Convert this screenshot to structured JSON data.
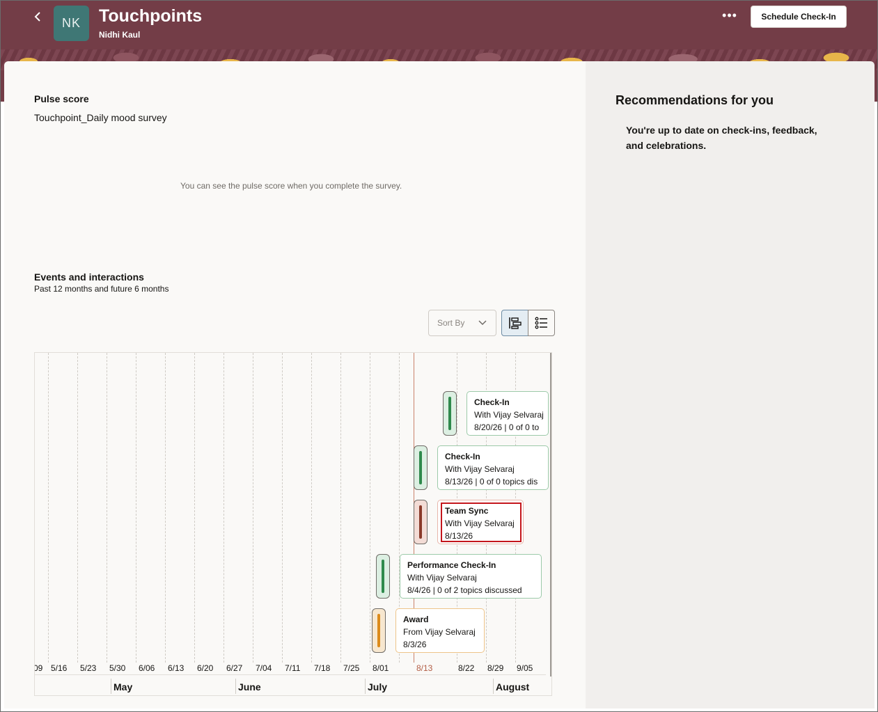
{
  "header": {
    "back_label": "‹",
    "avatar_initials": "NK",
    "title": "Touchpoints",
    "subtitle": "Nidhi Kaul",
    "more_label": "•••",
    "schedule_label": "Schedule Check-In",
    "colors": {
      "band": "#733d47",
      "avatar": "#3f7775"
    }
  },
  "pulse": {
    "title": "Pulse score",
    "survey_name": "Touchpoint_Daily mood survey",
    "message": "You can see the pulse score when you complete the survey."
  },
  "events": {
    "title": "Events and interactions",
    "subtitle": "Past 12 months and future 6 months",
    "sort_label": "Sort By",
    "view_modes": [
      "timeline-view-icon",
      "list-view-icon"
    ],
    "ticks": [
      "09",
      "5/16",
      "5/23",
      "5/30",
      "6/06",
      "6/13",
      "6/20",
      "6/27",
      "7/04",
      "7/11",
      "7/18",
      "7/25",
      "8/01",
      "8/13",
      "8/22",
      "8/29",
      "9/05"
    ],
    "today_tick": "8/13",
    "months": [
      "May",
      "June",
      "July",
      "August"
    ],
    "items": [
      {
        "type": "Check-In",
        "with": "With Vijay Selvaraj",
        "detail": "8/20/26 | 0 of 0 to",
        "color": "green"
      },
      {
        "type": "Check-In",
        "with": "With Vijay Selvaraj",
        "detail": "8/13/26 | 0 of 0 topics dis",
        "color": "green"
      },
      {
        "type": "Team Sync",
        "with": "With Vijay Selvaraj",
        "detail": "8/13/26",
        "color": "red"
      },
      {
        "type": "Performance Check-In",
        "with": "With Vijay Selvaraj",
        "detail": "8/4/26 | 0 of 2 topics discussed",
        "color": "green"
      },
      {
        "type": "Award",
        "with": "From Vijay Selvaraj",
        "detail": "8/3/26",
        "color": "orange"
      }
    ]
  },
  "recommendations": {
    "title": "Recommendations for you",
    "message": "You're up to date on check-ins, feedback, and celebrations."
  }
}
